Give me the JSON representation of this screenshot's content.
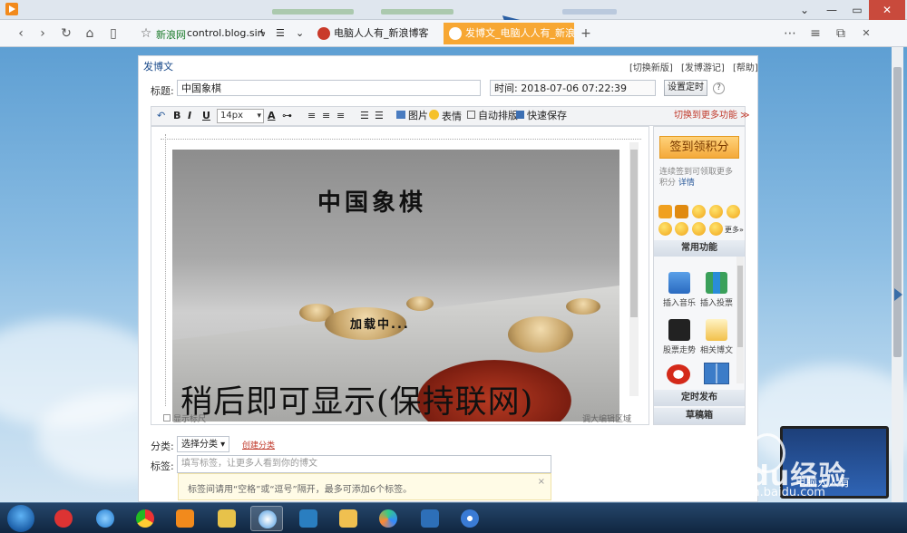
{
  "browser": {
    "window_controls": {
      "menu": "⌄",
      "minimize": "—",
      "maximize": "▭",
      "close": "✕"
    },
    "nav": {
      "back": "‹",
      "forward": "›",
      "refresh": "↻",
      "home": "⌂",
      "reader": "▯",
      "star": "☆"
    },
    "bookmark_site": "新浪网",
    "address": "control.blog.sin",
    "bolt": "ϟ",
    "list": "☰",
    "caret": "⌄",
    "tabs": [
      {
        "label": "电脑人人有_新浪博客",
        "active": false
      },
      {
        "label": "发博文_电脑人人有_新浪博",
        "active": true
      }
    ],
    "new_tab": "+",
    "right_icons": {
      "grid": "⋯",
      "menu": "≡",
      "restore": "⧉",
      "close": "✕"
    }
  },
  "blog": {
    "section_title": "发博文",
    "top_links": [
      "[切换新版]",
      "[发博游记]",
      "[帮助]"
    ],
    "title_label": "标题:",
    "title_value": "中国象棋",
    "time_label": "时间:",
    "time_value": "2018-07-06 07:22:39",
    "set_time_button": "设置定时",
    "help_icon": "?",
    "toolbar": {
      "undo": "↶",
      "bold": "B",
      "italic": "I",
      "underline": "U",
      "font_size": "14px",
      "font_color": "A",
      "link": "⊶",
      "align_left": "≡",
      "align_center": "≡",
      "align_right": "≡",
      "list_ul": "☰",
      "list_ol": "☰",
      "image": "图片",
      "emoji": "表情",
      "auto_layout": "自动排版",
      "quick_save": "快速保存",
      "more": "切换到更多功能 ≫"
    },
    "video": {
      "title": "中国象棋",
      "loading": "加载中...",
      "overlay": "稍后即可显示(保持联网)"
    },
    "editor_footer": {
      "left": "显示标尺",
      "right": "调大编辑区域"
    },
    "sidebar": {
      "sign_button": "签到领积分",
      "note": "连续签到可领取更多积分",
      "details": "详情",
      "emoji_more": "更多»",
      "common_header": "常用功能",
      "tools": [
        "插入音乐",
        "插入投票",
        "股票走势",
        "相关博文"
      ],
      "schedule_header": "定时发布",
      "draft_header": "草稿箱"
    },
    "category_label": "分类:",
    "category_select": "选择分类 ▾",
    "create_category": "创建分类",
    "tag_label": "标签:",
    "tag_placeholder": "填写标签，让更多人看到你的博文",
    "tag_tip": "标签间请用“空格”或“逗号”隔开，最多可添加6个标签。",
    "tag_tip_close": "×"
  },
  "overlay": {
    "watermark": "Baidu经验",
    "watermark_url": "jingyan.baidu.com",
    "laptop_caption": "电脑人人有"
  },
  "taskbar": {
    "items": [
      "start",
      "jiang",
      "ie",
      "chrome",
      "media",
      "explorer-folder",
      "browser-active",
      "remote",
      "folder",
      "pinwheel",
      "dots"
    ]
  }
}
